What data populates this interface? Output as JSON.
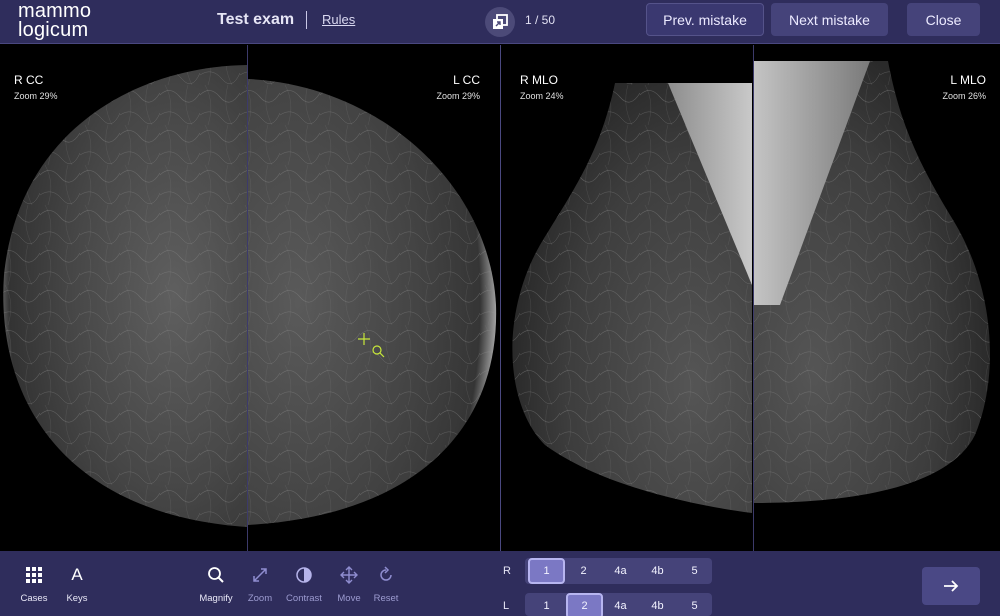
{
  "app": {
    "logo_line1": "mammo",
    "logo_line2": "logicum",
    "exam_title": "Test exam",
    "rules_link": "Rules",
    "counter": "1 / 50"
  },
  "header_buttons": {
    "prev": "Prev. mistake",
    "next": "Next mistake",
    "close": "Close"
  },
  "views": [
    {
      "label": "R CC",
      "zoom": "Zoom 29%"
    },
    {
      "label": "L CC",
      "zoom": "Zoom 29%"
    },
    {
      "label": "R MLO",
      "zoom": "Zoom 24%"
    },
    {
      "label": "L MLO",
      "zoom": "Zoom 26%"
    }
  ],
  "tools": {
    "cases": "Cases",
    "keys": "Keys",
    "keys_glyph": "A",
    "magnify": "Magnify",
    "zoom": "Zoom",
    "contrast": "Contrast",
    "move": "Move",
    "reset": "Reset"
  },
  "scoring": {
    "row_r_label": "R",
    "row_l_label": "L",
    "options": [
      "1",
      "2",
      "4a",
      "4b",
      "5"
    ],
    "selected_r": "1",
    "selected_l": "2"
  },
  "colors": {
    "bar_background": "#2f2d5c",
    "button_background": "#45437a",
    "selected_score": "#7b78c4",
    "cursor_marker": "#c8e83a"
  },
  "icons": {
    "stack": "copy-stack-icon",
    "cases": "grid-icon",
    "magnify": "search-icon",
    "zoom": "diagonal-arrows-icon",
    "contrast": "half-circle-icon",
    "move": "move-cross-icon",
    "reset": "reset-icon",
    "next": "arrow-right-icon"
  }
}
